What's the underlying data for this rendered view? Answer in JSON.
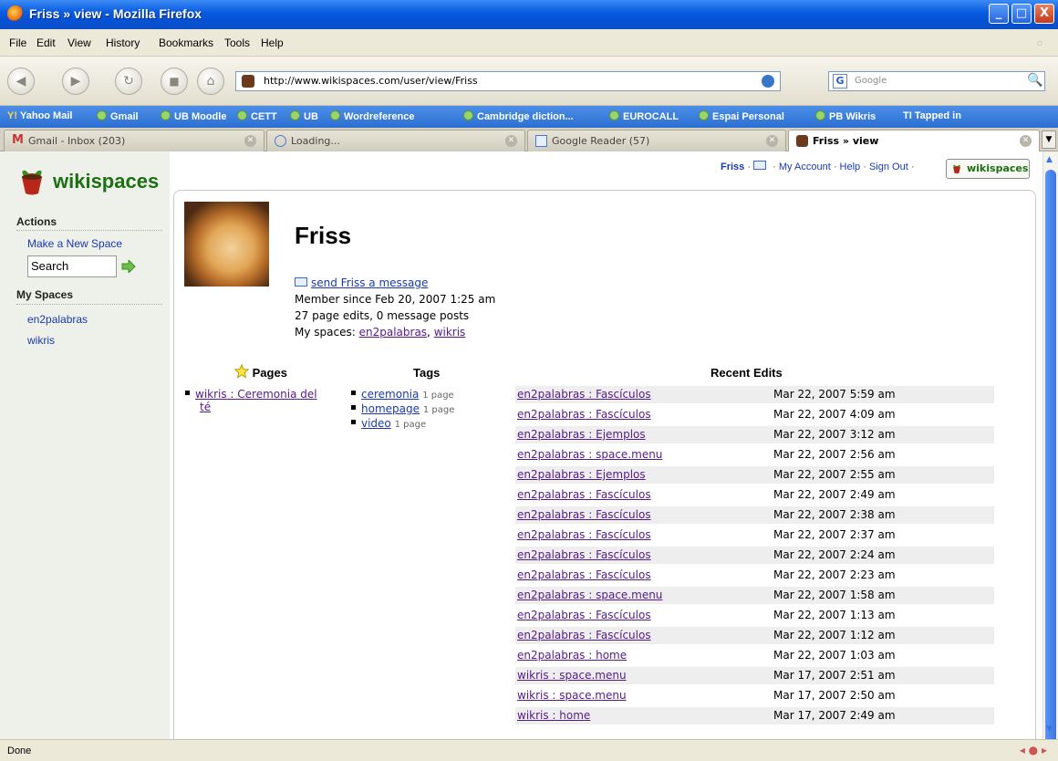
{
  "window": {
    "title": "Friss » view - Mozilla Firefox",
    "buttons": {
      "minimize": "_",
      "maximize": "□",
      "close": "X"
    }
  },
  "menu": [
    "File",
    "Edit",
    "View",
    "History",
    "Bookmarks",
    "Tools",
    "Help"
  ],
  "nav": {
    "url": "http://www.wikispaces.com/user/view/Friss",
    "search_placeholder": "Google",
    "search_engine": "G"
  },
  "bookmarks": [
    "Yahoo Mail",
    "Gmail",
    "UB Moodle",
    "CETT",
    "UB",
    "Wordreference",
    "Cambridge diction...",
    "EUROCALL",
    "Espai Personal",
    "PB Wikris",
    "Tapped in"
  ],
  "tabs": [
    {
      "label": "Gmail - Inbox (203)",
      "active": false
    },
    {
      "label": "Loading...",
      "active": false
    },
    {
      "label": "Google Reader (57)",
      "active": false
    },
    {
      "label": "Friss » view",
      "active": true
    }
  ],
  "status": "Done",
  "page": {
    "logo": "wikispaces",
    "topnav": {
      "user": "Friss",
      "account": "My Account",
      "help": "Help",
      "signout": "Sign Out",
      "badge": "wikispaces"
    },
    "sidebar": {
      "actions_heading": "Actions",
      "new_space": "Make a New Space",
      "search_value": "Search",
      "myspaces_heading": "My Spaces",
      "spaces": [
        "en2palabras",
        "wikris"
      ]
    },
    "profile": {
      "name": "Friss",
      "send_message": "send Friss a message",
      "member_since": "Member since Feb 20, 2007 1:25 am",
      "stats": "27 page edits, 0 message posts",
      "myspaces_label": "My spaces:",
      "spaces": [
        "en2palabras",
        "wikris"
      ]
    },
    "pages": {
      "heading": "Pages",
      "items": [
        "wikris : Ceremonia del",
        "té"
      ]
    },
    "tags": {
      "heading": "Tags",
      "items": [
        {
          "name": "ceremonia",
          "count": "1 page"
        },
        {
          "name": "homepage",
          "count": "1 page"
        },
        {
          "name": "video",
          "count": "1 page"
        }
      ]
    },
    "recent_edits": {
      "heading": "Recent Edits",
      "rows": [
        {
          "page": "en2palabras : Fascículos",
          "date": "Mar 22, 2007 5:59 am"
        },
        {
          "page": "en2palabras : Fascículos",
          "date": "Mar 22, 2007 4:09 am"
        },
        {
          "page": "en2palabras : Ejemplos",
          "date": "Mar 22, 2007 3:12 am"
        },
        {
          "page": "en2palabras : space.menu",
          "date": "Mar 22, 2007 2:56 am"
        },
        {
          "page": "en2palabras : Ejemplos",
          "date": "Mar 22, 2007 2:55 am"
        },
        {
          "page": "en2palabras : Fascículos",
          "date": "Mar 22, 2007 2:49 am"
        },
        {
          "page": "en2palabras : Fascículos",
          "date": "Mar 22, 2007 2:38 am"
        },
        {
          "page": "en2palabras : Fascículos",
          "date": "Mar 22, 2007 2:37 am"
        },
        {
          "page": "en2palabras : Fascículos",
          "date": "Mar 22, 2007 2:24 am"
        },
        {
          "page": "en2palabras : Fascículos",
          "date": "Mar 22, 2007 2:23 am"
        },
        {
          "page": "en2palabras : space.menu",
          "date": "Mar 22, 2007 1:58 am"
        },
        {
          "page": "en2palabras : Fascículos",
          "date": "Mar 22, 2007 1:13 am"
        },
        {
          "page": "en2palabras : Fascículos",
          "date": "Mar 22, 2007 1:12 am"
        },
        {
          "page": "en2palabras : home",
          "date": "Mar 22, 2007 1:03 am"
        },
        {
          "page": "wikris : space.menu",
          "date": "Mar 17, 2007 2:51 am"
        },
        {
          "page": "wikris : space.menu",
          "date": "Mar 17, 2007 2:50 am"
        },
        {
          "page": "wikris : home",
          "date": "Mar 17, 2007 2:49 am"
        }
      ]
    }
  },
  "colors": {
    "brand_green": "#1c6f12",
    "link_visited": "#551a8b",
    "link": "#1a39b0",
    "xp_blue": "#0a5de0"
  },
  "icons": [
    "firefox-icon",
    "back-icon",
    "forward-icon",
    "reload-icon",
    "stop-icon",
    "home-icon",
    "go-icon",
    "search-icon",
    "star-icon",
    "mail-icon",
    "wikispaces-logo-icon",
    "arrow-right-icon"
  ]
}
